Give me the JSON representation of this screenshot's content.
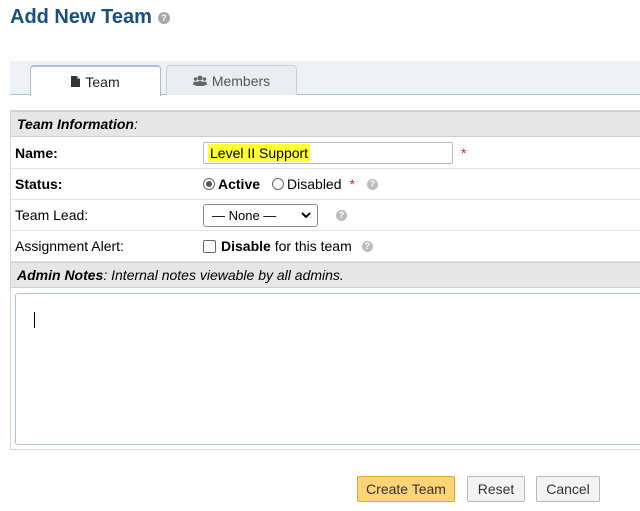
{
  "page": {
    "title": "Add New Team",
    "help_icon": "question-circle-icon"
  },
  "tabs": [
    {
      "label": "Team",
      "icon": "file-icon",
      "active": true
    },
    {
      "label": "Members",
      "icon": "users-icon",
      "active": false
    }
  ],
  "team_information": {
    "header_bold": "Team Information",
    "header_suffix": ":"
  },
  "fields": {
    "name": {
      "label": "Name:",
      "value": "Level II Support",
      "required_mark": "*"
    },
    "status": {
      "label": "Status:",
      "options": [
        "Active",
        "Disabled"
      ],
      "selected": "Active",
      "required_mark": "*"
    },
    "team_lead": {
      "label": "Team Lead:",
      "selected": "— None —"
    },
    "assignment_alert": {
      "label": "Assignment Alert:",
      "checkbox_bold": "Disable",
      "checkbox_text": " for this team",
      "checked": false
    }
  },
  "admin_notes": {
    "header_bold": "Admin Notes",
    "header_text": ": Internal notes viewable by all admins.",
    "value": ""
  },
  "buttons": {
    "create": "Create Team",
    "reset": "Reset",
    "cancel": "Cancel"
  },
  "colors": {
    "title": "#184e80",
    "create_button": "#fbd478",
    "highlight": "#ffff33",
    "required": "#d62020"
  }
}
